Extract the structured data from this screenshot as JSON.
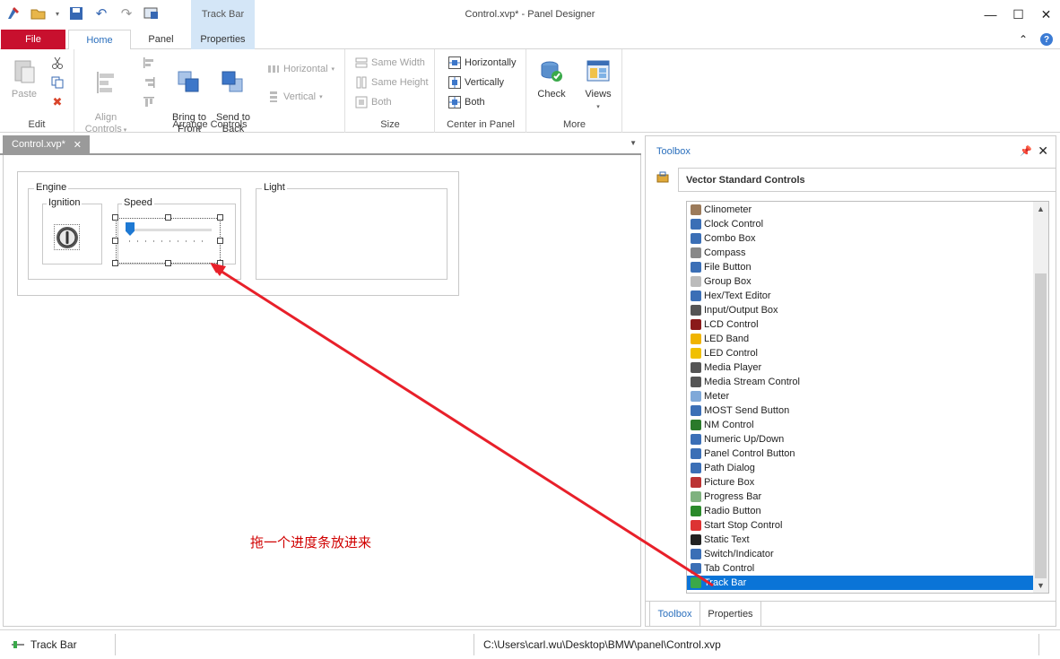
{
  "window": {
    "title": "Control.xvp* - Panel Designer",
    "contextual_tab": "Track Bar"
  },
  "ribbon_tabs": {
    "file": "File",
    "home": "Home",
    "panel": "Panel",
    "properties": "Properties"
  },
  "ribbon": {
    "edit": {
      "label": "Edit",
      "paste": "Paste"
    },
    "arrange": {
      "label": "Arrange Controls",
      "align_controls": "Align\nControls",
      "bring_to_front": "Bring to\nFront",
      "send_to_back": "Send to\nBack",
      "horizontal": "Horizontal",
      "vertical": "Vertical"
    },
    "size": {
      "label": "Size",
      "same_width": "Same Width",
      "same_height": "Same Height",
      "both": "Both"
    },
    "center": {
      "label": "Center in Panel",
      "horizontally": "Horizontally",
      "vertically": "Vertically",
      "both": "Both"
    },
    "more": {
      "label": "More",
      "check": "Check",
      "views": "Views"
    }
  },
  "document": {
    "tab": "Control.xvp*",
    "groups": {
      "engine": "Engine",
      "ignition": "Ignition",
      "speed": "Speed",
      "light": "Light"
    },
    "annotation": "拖一个进度条放进来"
  },
  "toolbox": {
    "title": "Toolbox",
    "category": "Vector Standard Controls",
    "items": [
      "Clinometer",
      "Clock Control",
      "Combo Box",
      "Compass",
      "File Button",
      "Group Box",
      "Hex/Text Editor",
      "Input/Output Box",
      "LCD Control",
      "LED Band",
      "LED Control",
      "Media Player",
      "Media Stream Control",
      "Meter",
      "MOST Send Button",
      "NM Control",
      "Numeric Up/Down",
      "Panel Control Button",
      "Path Dialog",
      "Picture Box",
      "Progress Bar",
      "Radio Button",
      "Start Stop Control",
      "Static Text",
      "Switch/Indicator",
      "Tab Control",
      "Track Bar"
    ],
    "selected_item": "Track Bar",
    "pane_tabs": {
      "toolbox": "Toolbox",
      "properties": "Properties"
    }
  },
  "statusbar": {
    "selected_control": "Track Bar",
    "path": "C:\\Users\\carl.wu\\Desktop\\BMW\\panel\\Control.xvp"
  },
  "colors": {
    "file_tab": "#c8102e",
    "accent_blue": "#2a6fbd",
    "selection": "#0a74d7",
    "annotation_red": "#d00000"
  }
}
